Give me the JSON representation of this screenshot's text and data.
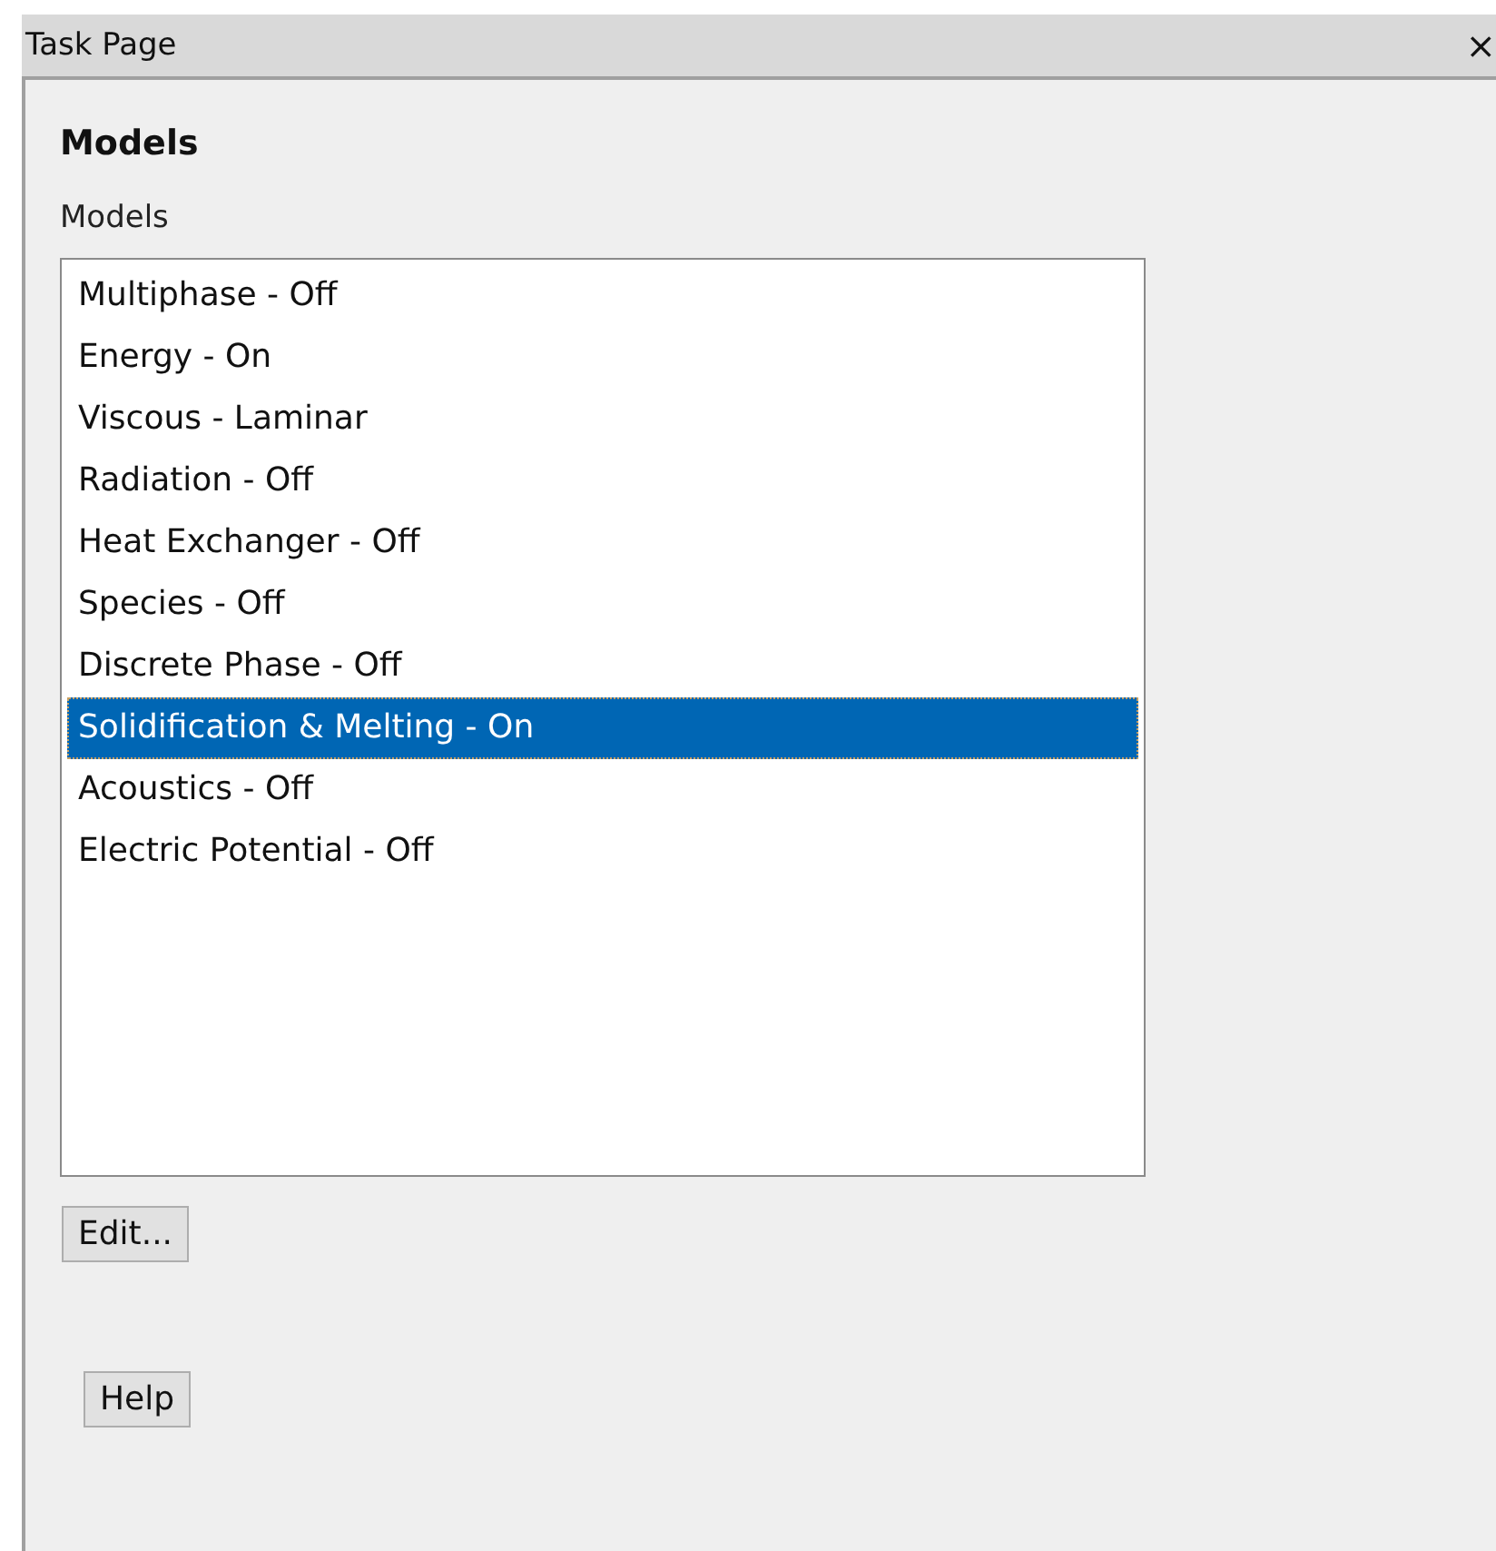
{
  "window": {
    "title": "Task Page",
    "close": "×"
  },
  "heading": "Models",
  "list_label": "Models",
  "models": [
    {
      "label": "Multiphase - Off",
      "selected": false
    },
    {
      "label": "Energy - On",
      "selected": false
    },
    {
      "label": "Viscous - Laminar",
      "selected": false
    },
    {
      "label": "Radiation - Off",
      "selected": false
    },
    {
      "label": "Heat Exchanger - Off",
      "selected": false
    },
    {
      "label": "Species - Off",
      "selected": false
    },
    {
      "label": "Discrete Phase - Off",
      "selected": false
    },
    {
      "label": "Solidification & Melting - On",
      "selected": true
    },
    {
      "label": "Acoustics - Off",
      "selected": false
    },
    {
      "label": "Electric Potential - Off",
      "selected": false
    }
  ],
  "buttons": [
    {
      "label": "Edit..."
    },
    {
      "label": "Help"
    }
  ]
}
